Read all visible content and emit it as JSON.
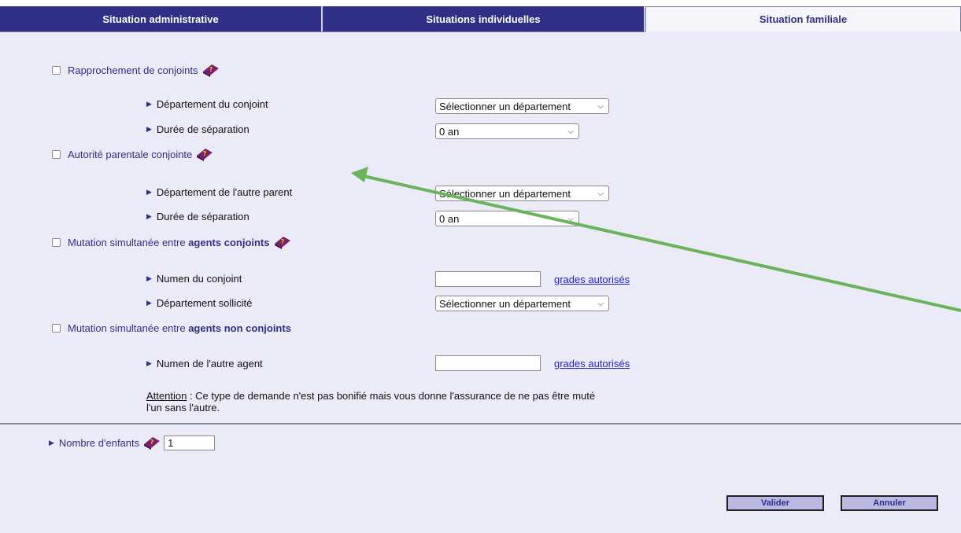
{
  "tabs": [
    {
      "label": "Situation administrative",
      "active": false
    },
    {
      "label": "Situations individuelles",
      "active": false
    },
    {
      "label": "Situation familiale",
      "active": true
    }
  ],
  "sections": {
    "rapprochement": {
      "label": "Rapprochement de conjoints",
      "dept_label": "Département du conjoint",
      "dept_value": "Sélectionner un département",
      "duree_label": "Durée de séparation",
      "duree_value": "0 an"
    },
    "autorite": {
      "label": "Autorité parentale conjointe",
      "dept_label": "Département de l'autre parent",
      "dept_value": "Sélectionner un département",
      "duree_label": "Durée de séparation",
      "duree_value": "0 an"
    },
    "mutation_conjoints": {
      "label_prefix": "Mutation simultanée entre ",
      "label_bold": "agents conjoints",
      "numen_label": "Numen du conjoint",
      "numen_value": "",
      "grades_link": "grades autorisés",
      "dept_label": "Département sollicité",
      "dept_value": "Sélectionner un département"
    },
    "mutation_non_conjoints": {
      "label_prefix": "Mutation simultanée entre ",
      "label_bold": "agents non conjoints",
      "numen_label": "Numen de l'autre agent",
      "numen_value": "",
      "grades_link": "grades autorisés"
    }
  },
  "note": {
    "attention": "Attention",
    "text_line1": " : Ce type de demande n'est pas bonifié mais vous donne l'assurance de ne pas être muté",
    "text_line2": "l'un sans l'autre."
  },
  "enfants": {
    "label": "Nombre d'enfants",
    "value": "1"
  },
  "buttons": {
    "valider": "Valider",
    "annuler": "Annuler"
  },
  "colors": {
    "tab_dark": "#2f2f86",
    "background": "#ebebf7",
    "link": "#2222cc",
    "annotation_arrow": "#6db35e"
  }
}
